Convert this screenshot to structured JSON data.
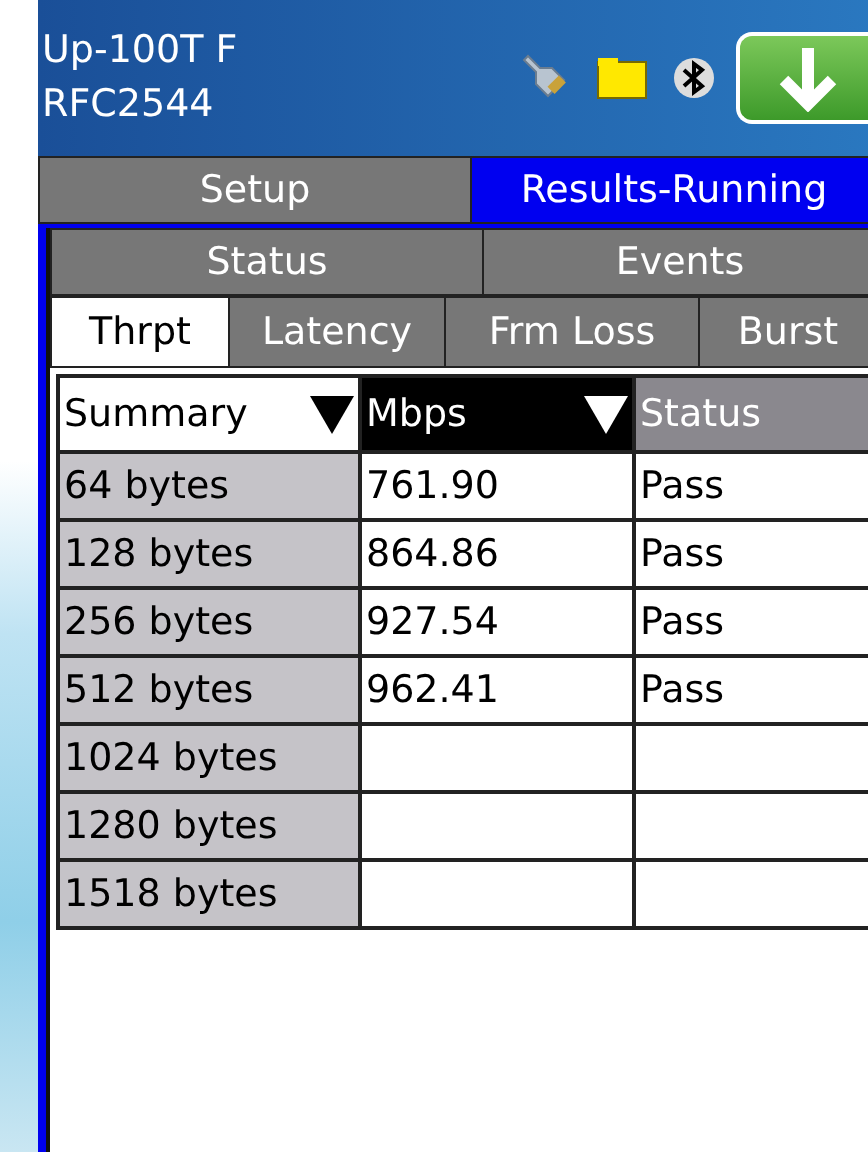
{
  "header": {
    "title_lines": [
      "Up-100T F",
      "RFC2544"
    ]
  },
  "main_tabs": [
    {
      "label": "Setup",
      "selected": false
    },
    {
      "label": "Results-Running",
      "selected": true
    }
  ],
  "view_tabs": [
    {
      "label": "Status",
      "selected": false
    },
    {
      "label": "Events",
      "selected": false
    }
  ],
  "test_tabs": [
    {
      "label": "Thrpt",
      "selected": true
    },
    {
      "label": "Latency",
      "selected": false
    },
    {
      "label": "Frm Loss",
      "selected": false
    },
    {
      "label": "Burst",
      "selected": false
    }
  ],
  "table": {
    "columns": [
      {
        "label": "Summary",
        "kind": "dropdown-light"
      },
      {
        "label": "Mbps",
        "kind": "dropdown-dark"
      },
      {
        "label": "Status",
        "kind": "plain"
      }
    ],
    "rows": [
      [
        "64 bytes",
        "761.90",
        "Pass"
      ],
      [
        "128 bytes",
        "864.86",
        "Pass"
      ],
      [
        "256 bytes",
        "927.54",
        "Pass"
      ],
      [
        "512 bytes",
        "962.41",
        "Pass"
      ],
      [
        "1024 bytes",
        "",
        ""
      ],
      [
        "1280 bytes",
        "",
        ""
      ],
      [
        "1518 bytes",
        "",
        ""
      ]
    ]
  }
}
